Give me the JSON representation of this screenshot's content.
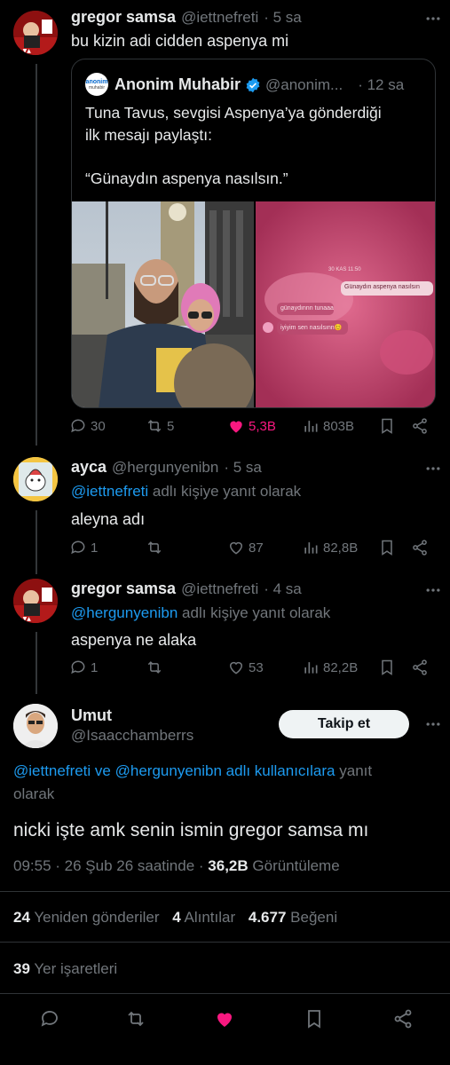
{
  "tweet1": {
    "name": "gregor samsa",
    "handle": "@iettnefreti",
    "time": "· 5 sa",
    "text": "bu kizin adi cidden aspenya mi",
    "quote": {
      "name": "Anonim Muhabir",
      "handle": "@anonim...",
      "time": "· 12 sa",
      "logo_text": "anonim",
      "logo_sub": "muhabir",
      "line1": "Tuna Tavus, sevgisi Aspenya’ya gönderdiği",
      "line2": "ilk mesajı paylaştı:",
      "line3": "“Günaydın aspenya nasılsın.”",
      "chat_date": "30 KAS 11:50",
      "chat_msg1": "Günaydın aspenya nasılsın",
      "chat_msg2": "günaydınnn tunaaa",
      "chat_msg3": "iyiyim sen nasılsınn😊"
    },
    "replies": "30",
    "reposts": "5",
    "likes": "5,3B",
    "views": "803B"
  },
  "tweet2": {
    "name": "ayca",
    "handle": "@hergunyenibn",
    "time": "· 5 sa",
    "reply_to": "@iettnefreti",
    "reply_suffix": "adlı kişiye yanıt olarak",
    "text": "aleyna adı",
    "replies": "1",
    "likes": "87",
    "views": "82,8B"
  },
  "tweet3": {
    "name": "gregor samsa",
    "handle": "@iettnefreti",
    "time": "· 4 sa",
    "reply_to": "@hergunyenibn",
    "reply_suffix": "adlı kişiye yanıt olarak",
    "text": "aspenya ne alaka",
    "replies": "1",
    "likes": "53",
    "views": "82,2B"
  },
  "main": {
    "name": "Umut",
    "handle": "@Isaacchamberrs",
    "follow_label": "Takip et",
    "reply_to_1": "@iettnefreti",
    "reply_and": "ve",
    "reply_to_2": "@hergunyenibn",
    "reply_mid": "adlı kullanıcılara",
    "reply_end1": "yanıt",
    "reply_end2": "olarak",
    "text": "nicki işte amk senin ismin gregor samsa mı",
    "time": "09:55 · 26 Şub 26 saatinde ·",
    "views_count": "36,2B",
    "views_label": "Görüntüleme",
    "reposts_count": "24",
    "reposts_label": "Yeniden gönderiler",
    "quotes_count": "4",
    "quotes_label": "Alıntılar",
    "likes_count": "4.677",
    "likes_label": "Beğeni",
    "bookmarks_count": "39",
    "bookmarks_label": "Yer işaretleri"
  },
  "colors": {
    "accent": "#1d9bf0",
    "like": "#f91880",
    "muted": "#71767b"
  }
}
